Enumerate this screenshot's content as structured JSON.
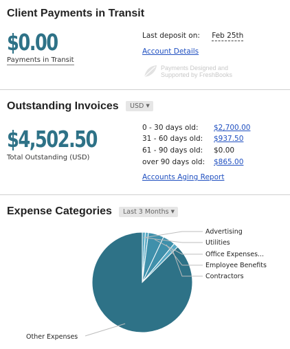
{
  "client_payments": {
    "title": "Client Payments in Transit",
    "amount": "$0.00",
    "amount_label": "Payments in Transit",
    "last_deposit_label": "Last deposit on:",
    "last_deposit_value": "Feb 25th",
    "account_details_link": "Account Details",
    "freshbooks_note_line1": "Payments Designed and",
    "freshbooks_note_line2": "Supported by FreshBooks"
  },
  "outstanding": {
    "title": "Outstanding Invoices",
    "currency_selector": "USD",
    "amount": "$4,502.50",
    "amount_label": "Total Outstanding (USD)",
    "aging": [
      {
        "label": "0 - 30 days old:",
        "value": "$2,700.00",
        "is_link": true
      },
      {
        "label": "31 - 60 days old:",
        "value": "$937.50",
        "is_link": true
      },
      {
        "label": "61 - 90 days old:",
        "value": "$0.00",
        "is_link": false
      },
      {
        "label": "over 90 days old:",
        "value": "$865.00",
        "is_link": true
      }
    ],
    "report_link": "Accounts Aging Report"
  },
  "expenses": {
    "title": "Expense Categories",
    "period_selector": "Last 3 Months",
    "colors": {
      "main": "#2e7287",
      "slice_light": "#5aaac4",
      "slice_mid": "#3f90ab",
      "leader": "#bdbdbd"
    },
    "chart_data": {
      "type": "pie",
      "categories": [
        "Advertising",
        "Utilities",
        "Office Expenses...",
        "Employee Benefits",
        "Contractors",
        "Other Expenses"
      ],
      "values": [
        1,
        1,
        5,
        4,
        1.5,
        87.5
      ]
    }
  }
}
